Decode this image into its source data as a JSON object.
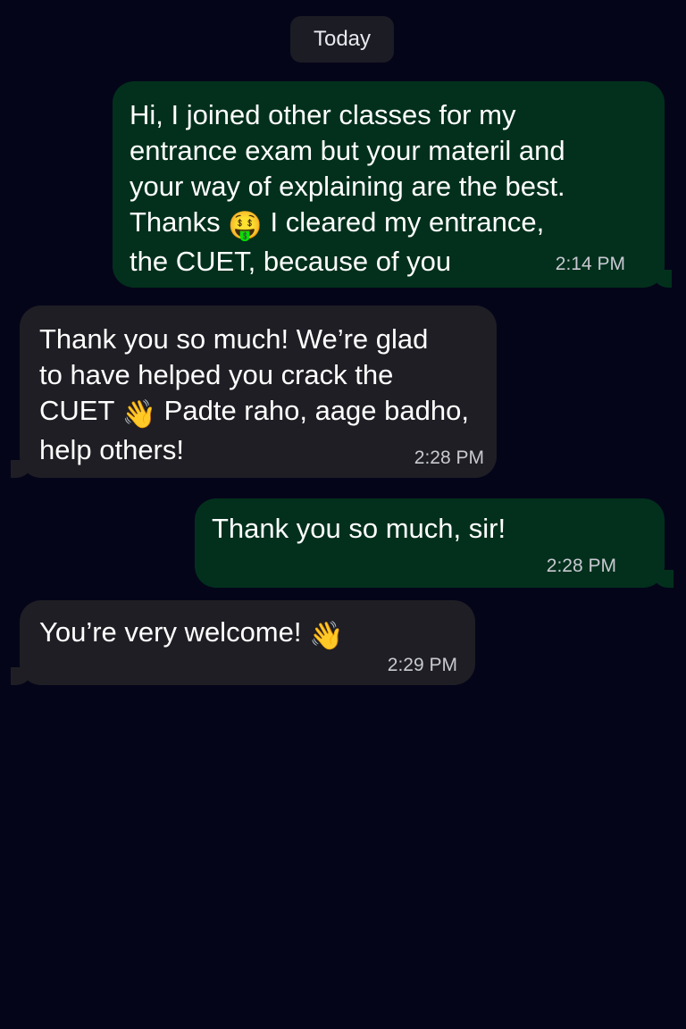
{
  "chat": {
    "day_label": "Today",
    "messages": [
      {
        "direction": "outgoing",
        "text_before": "Hi, I joined other classes for my\nentrance exam but your materil and\nyour way of explaining are the best.\nThanks ",
        "emoji": "🤑",
        "emoji_icon": "grinning-face-icon",
        "text_after": " I cleared my entrance,\nthe CUET, because of you",
        "time": "2:14 PM"
      },
      {
        "direction": "incoming",
        "text_before": "Thank you so much! We’re glad\nto have helped you crack the\nCUET ",
        "emoji": "👋",
        "emoji_icon": "waving-hand-icon",
        "text_after": " Padte raho, aage badho,\nhelp others!",
        "time": "2:28 PM"
      },
      {
        "direction": "outgoing",
        "text": "Thank you so much, sir!",
        "time": "2:28 PM"
      },
      {
        "direction": "incoming",
        "text_before": "You’re very welcome! ",
        "emoji": "👋",
        "emoji_icon": "waving-hand-icon",
        "time": "2:29 PM"
      }
    ]
  },
  "colors": {
    "background": "#05051a",
    "outgoing_bubble": "#02301c",
    "incoming_bubble": "#1e1e24",
    "date_chip": "#1c1c24",
    "timestamp": "#c9c9d1"
  }
}
